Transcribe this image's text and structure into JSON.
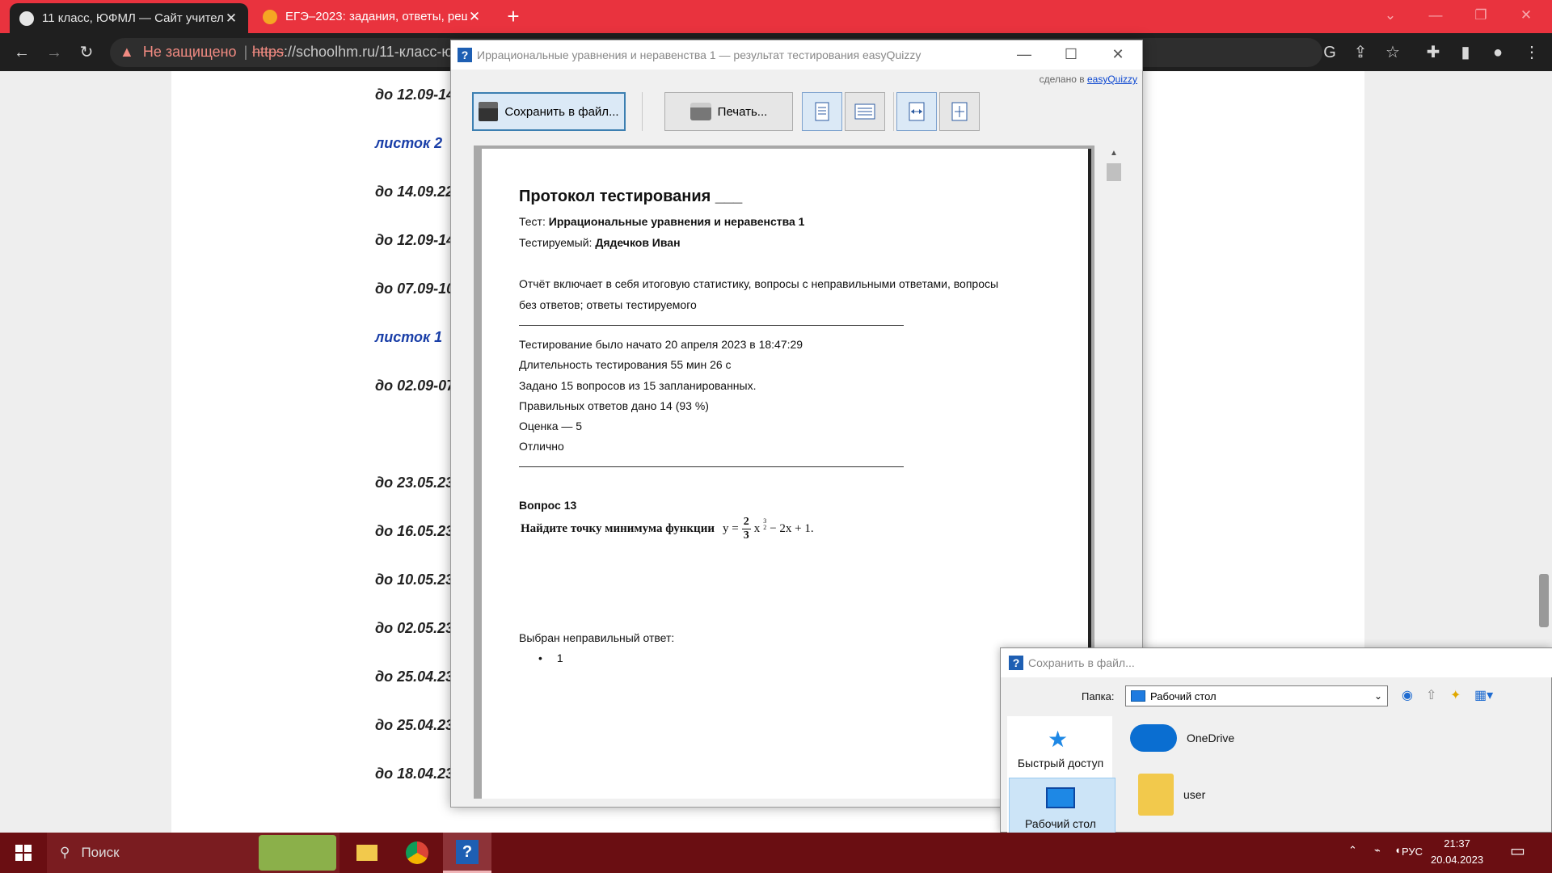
{
  "browser": {
    "tabs": [
      {
        "title": "11 класс, ЮФМЛ — Сайт учител",
        "active": true,
        "icon": "globe-icon"
      },
      {
        "title": "ЕГЭ–2023: задания, ответы, реш",
        "active": false,
        "icon": "ege-favicon-icon"
      }
    ],
    "security_label": "Не защищено",
    "url_scheme": "https",
    "url_rest": "://schoolhm.ru/11-класс-ю"
  },
  "page_links": [
    {
      "text": "до 12.09-14",
      "blue": false
    },
    {
      "text": "листок 2",
      "blue": true
    },
    {
      "text": "до 14.09.22",
      "blue": false
    },
    {
      "text": "до 12.09-14",
      "blue": false
    },
    {
      "text": "до 07.09-10",
      "blue": false
    },
    {
      "text": "листок 1",
      "blue": true
    },
    {
      "text": "до 02.09-07",
      "blue": false
    },
    {
      "text": "до 23.05.23",
      "blue": false
    },
    {
      "text": "до 16.05.23",
      "blue": false
    },
    {
      "text": "до 10.05.23",
      "blue": false
    },
    {
      "text": "до 02.05.23",
      "blue": false
    },
    {
      "text": "до 25.04.23",
      "blue": false
    },
    {
      "text": "до 25.04.23",
      "blue": false
    },
    {
      "text": "до 18.04.23",
      "blue": false
    }
  ],
  "eq_window": {
    "title": "Иррациональные уравнения и неравенства 1 — результат тестирования easyQuizzy",
    "made_in_prefix": "сделано в",
    "made_in_link": "easyQuizzy",
    "save_label": "Сохранить в файл...",
    "print_label": "Печать..."
  },
  "report": {
    "heading": "Протокол тестирования ___",
    "test_label": "Тест:",
    "test_name": "Иррациональные уравнения и неравенства 1",
    "tester_label": "Тестируемый:",
    "tester_name": "Дядечков Иван",
    "intro_line1": "Отчёт включает в себя итоговую статистику, вопросы с неправильными ответами, вопросы",
    "intro_line2": "без ответов; ответы тестируемого",
    "started": "Тестирование было начато 20 апреля 2023 в 18:47:29",
    "duration": "Длительность тестирования 55 мин 26 с",
    "asked": "Задано 15 вопросов из 15 запланированных.",
    "correct": "Правильных ответов дано 14 (93 %)",
    "grade": "Оценка — 5",
    "grade_word": "Отлично",
    "question_heading": "Вопрос 13",
    "question_text": "Найдите точку минимума функции",
    "formula_y": "y =",
    "formula_num": "2",
    "formula_den": "3",
    "formula_x": "x",
    "formula_exp_num": "3",
    "formula_exp_den": "2",
    "formula_rest": "− 2x + 1.",
    "wrong_label": "Выбран неправильный ответ:",
    "answer": "1"
  },
  "save_dialog": {
    "title": "Сохранить в файл...",
    "folder_label": "Папка:",
    "folder_value": "Рабочий стол",
    "nav_quick": "Быстрый доступ",
    "nav_desktop": "Рабочий стол",
    "files": [
      "OneDrive",
      "user"
    ]
  },
  "taskbar": {
    "search_placeholder": "Поиск",
    "lang": "РУС",
    "time": "21:37",
    "date": "20.04.2023"
  },
  "colors": {
    "accent": "#e9333e",
    "taskbar": "#6a0e12",
    "link_blue": "#1a3fa8"
  }
}
